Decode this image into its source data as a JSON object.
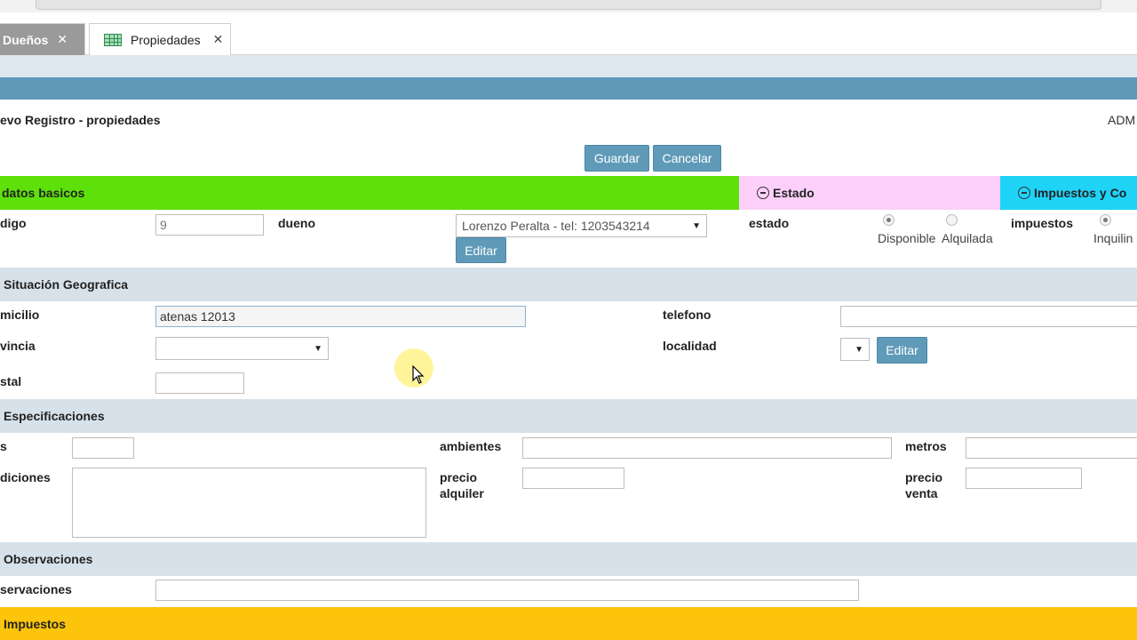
{
  "tabs": [
    {
      "label": "Dueños",
      "close": "✕"
    },
    {
      "label": "Propiedades",
      "close": "✕"
    }
  ],
  "page": {
    "title": "evo Registro - propiedades",
    "user": "ADM"
  },
  "actions": {
    "save": "Guardar",
    "cancel": "Cancelar"
  },
  "bands": {
    "basic": "datos basicos",
    "estado": "Estado",
    "impuestos": "Impuestos y Co"
  },
  "basic": {
    "codigo_label": "digo",
    "codigo_value": "9",
    "dueno_label": "dueno",
    "dueno_value": "Lorenzo Peralta - tel: 1203543214",
    "dueno_edit": "Editar",
    "estado_label": "estado",
    "estado_options": [
      "Disponible",
      "Alquilada"
    ],
    "estado_selected": "Disponible",
    "impuestos_label": "impuestos",
    "impuestos_option": "Inquilin"
  },
  "geo": {
    "section": "Situación Geografica",
    "domicilio_label": "micilio",
    "domicilio_value": "atenas 12013",
    "telefono_label": "telefono",
    "telefono_value": "",
    "provincia_label": "vincia",
    "provincia_value": "",
    "localidad_label": "localidad",
    "localidad_value": "",
    "localidad_edit": "Editar",
    "postal_label": "stal",
    "postal_value": ""
  },
  "specs": {
    "section": "Especificaciones",
    "first_label": "s",
    "ambientes_label": "ambientes",
    "metros_label": "metros",
    "condiciones_label": "diciones",
    "precio_alquiler_label": "precio alquiler",
    "precio_venta_label": "precio venta"
  },
  "obs": {
    "section": "Observaciones",
    "label": "servaciones",
    "value": ""
  },
  "taxes": {
    "section": "Impuestos"
  },
  "colors": {
    "accent_button": "#5f9ab9",
    "band_basic": "#5ee00a",
    "band_estado": "#fcd0fb",
    "band_impuestos": "#1fd3f7",
    "band_taxes": "#fcc40a",
    "section_bg": "#d6e1ea"
  }
}
